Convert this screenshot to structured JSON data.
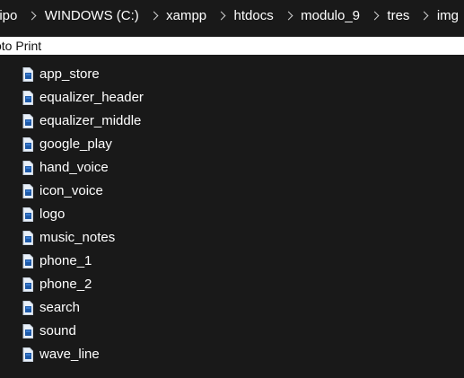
{
  "breadcrumb": {
    "items": [
      "uipo",
      "WINDOWS (C:)",
      "xampp",
      "htdocs",
      "modulo_9",
      "tres",
      "img"
    ]
  },
  "print_bar": {
    "label": "oto Print"
  },
  "files": [
    {
      "name": "app_store",
      "icon": "image-file-icon"
    },
    {
      "name": "equalizer_header",
      "icon": "image-file-icon"
    },
    {
      "name": "equalizer_middle",
      "icon": "image-file-icon"
    },
    {
      "name": "google_play",
      "icon": "image-file-icon"
    },
    {
      "name": "hand_voice",
      "icon": "image-file-icon"
    },
    {
      "name": "icon_voice",
      "icon": "image-file-icon"
    },
    {
      "name": "logo",
      "icon": "image-file-icon"
    },
    {
      "name": "music_notes",
      "icon": "image-file-icon"
    },
    {
      "name": "phone_1",
      "icon": "image-file-icon"
    },
    {
      "name": "phone_2",
      "icon": "image-file-icon"
    },
    {
      "name": "search",
      "icon": "image-file-icon"
    },
    {
      "name": "sound",
      "icon": "image-file-icon"
    },
    {
      "name": "wave_line",
      "icon": "image-file-icon"
    }
  ],
  "colors": {
    "background": "#191919",
    "text": "#ffffff",
    "print_bar_bg": "#ffffff",
    "print_bar_text": "#111111",
    "icon_blue": "#1e5aa8",
    "icon_light": "#e9f0f8"
  }
}
